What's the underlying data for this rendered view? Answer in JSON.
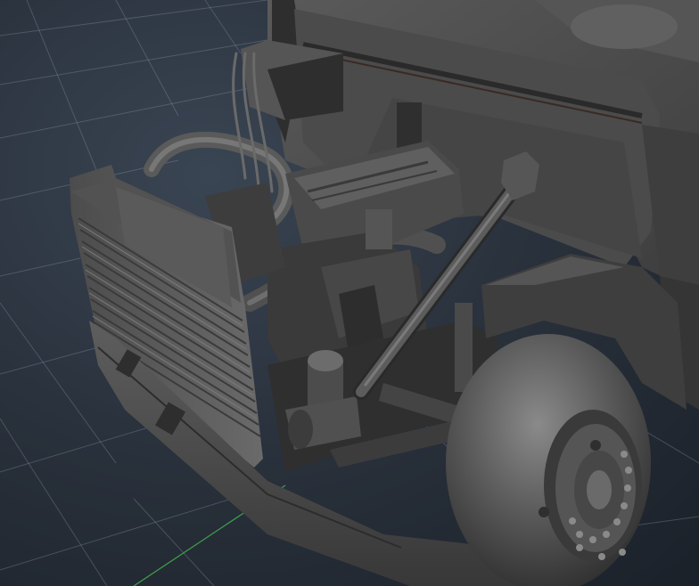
{
  "viewport": {
    "background_top": "#3a4553",
    "background_bottom": "#1b2129",
    "grid_color": "#8a97a6",
    "axis_green": "#3fa34d",
    "model_shade_light": "#6b6b6b",
    "model_shade_mid": "#4a4a4a",
    "model_shade_dark": "#2b2b2b",
    "model_shade_shadow": "#1c1c1c",
    "cab_accent": "#3a2a24"
  },
  "scene": {
    "object": "truck-front-model",
    "parts": [
      "cab",
      "hood-panel",
      "radiator-grille",
      "engine-block",
      "air-intake-pipes",
      "strut-rod",
      "oil-filter",
      "front-bumper",
      "front-wheel",
      "wheel-lug-nuts",
      "chassis-frame"
    ]
  }
}
